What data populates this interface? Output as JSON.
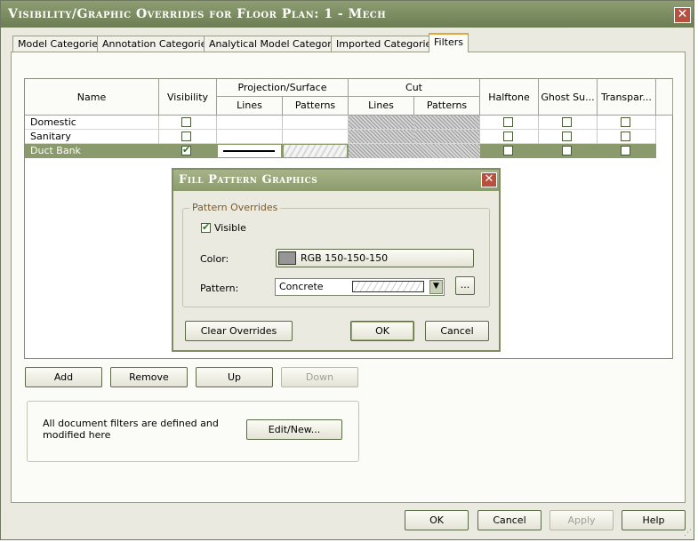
{
  "window": {
    "title": "Visibility/Graphic Overrides for Floor Plan: 1 - Mech"
  },
  "tabs": [
    "Model Categories",
    "Annotation Categories",
    "Analytical Model Categories",
    "Imported Categories",
    "Filters"
  ],
  "grid": {
    "headers": {
      "name": "Name",
      "visibility": "Visibility",
      "projection": "Projection/Surface",
      "cut": "Cut",
      "lines": "Lines",
      "patterns": "Patterns",
      "halftone": "Halftone",
      "ghost": "Ghost Su...",
      "transparent": "Transpar..."
    },
    "rows": [
      {
        "name": "Domestic",
        "visible": false,
        "halftone": false,
        "ghost": false,
        "transparent": false
      },
      {
        "name": "Sanitary",
        "visible": false,
        "halftone": false,
        "ghost": false,
        "transparent": false
      },
      {
        "name": "Duct Bank",
        "visible": true,
        "halftone": false,
        "ghost": false,
        "transparent": false
      }
    ],
    "selected_row": 2
  },
  "filter_buttons": {
    "add": "Add",
    "remove": "Remove",
    "up": "Up",
    "down": "Down"
  },
  "filters_info": {
    "text": "All document filters are defined and modified here",
    "edit_new": "Edit/New..."
  },
  "bottom_buttons": {
    "ok": "OK",
    "cancel": "Cancel",
    "apply": "Apply",
    "help": "Help"
  },
  "fill_dialog": {
    "title": "Fill Pattern Graphics",
    "group": "Pattern Overrides",
    "visible_label": "Visible",
    "visible_checked": true,
    "color_label": "Color:",
    "color_value": "RGB 150-150-150",
    "color_swatch": "#969696",
    "pattern_label": "Pattern:",
    "pattern_value": "Concrete",
    "ellipsis": "...",
    "clear_overrides": "Clear Overrides",
    "ok": "OK",
    "cancel": "Cancel"
  },
  "colors": {
    "title_bar": "#7a8b5e",
    "selected_row": "#8a9a6c",
    "tab_accent": "#e8a43c",
    "close_button": "#b85040"
  }
}
